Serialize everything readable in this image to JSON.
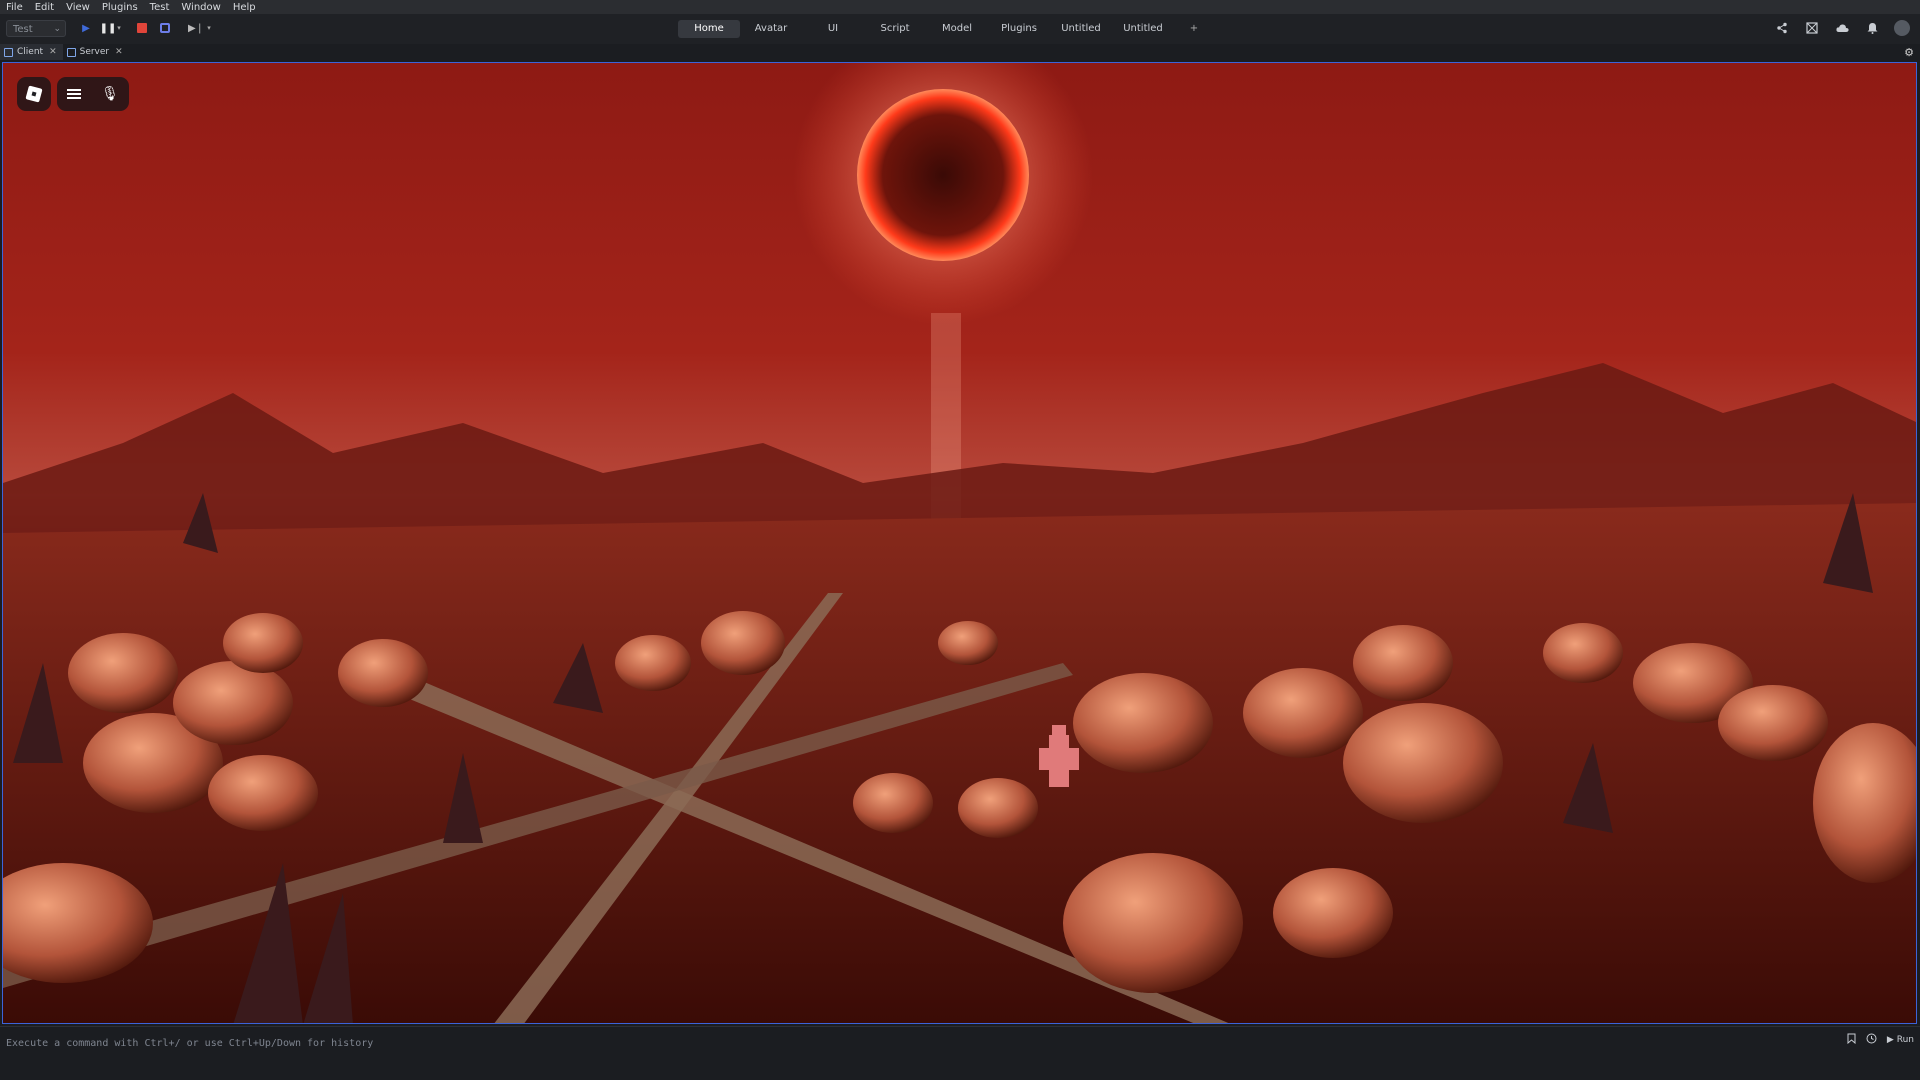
{
  "menu": [
    "File",
    "Edit",
    "View",
    "Plugins",
    "Test",
    "Window",
    "Help"
  ],
  "ribbon": {
    "test_select": "Test",
    "tabs": [
      "Home",
      "Avatar",
      "UI",
      "Script",
      "Model",
      "Plugins",
      "Untitled",
      "Untitled"
    ],
    "active_tab": "Home",
    "add_tab": "+"
  },
  "doc_tabs": [
    {
      "label": "Client",
      "active": true
    },
    {
      "label": "Server",
      "active": false
    }
  ],
  "command_bar": {
    "placeholder": "Execute a command with Ctrl+/ or use Ctrl+Up/Down for history",
    "run_label": "Run"
  },
  "icons": {
    "share": "share-icon",
    "team_create": "team-icon",
    "cloud": "cloud-icon",
    "bell": "bell-icon",
    "avatar": "avatar-icon",
    "settings": "gear-icon",
    "roblox": "roblox-logo-icon",
    "menu": "hamburger-menu-icon",
    "mic": "microphone-icon"
  },
  "colors": {
    "accent": "#3c63d9",
    "stop": "#e0453a",
    "sky": "#8c1812",
    "sun_glow": "#ff5a3a"
  }
}
